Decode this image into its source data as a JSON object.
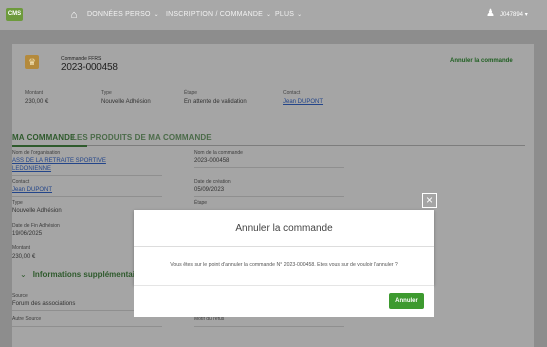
{
  "nav": {
    "logo_text": "CMS",
    "home_icon": "home-icon",
    "items": [
      {
        "label": "DONNÉES PERSO"
      },
      {
        "label": "INSCRIPTION / COMMANDE"
      },
      {
        "label": "PLUS"
      }
    ],
    "user": "J047894 ▾"
  },
  "order": {
    "kind": "Commande FFRS",
    "number": "2023-000458",
    "cancel_label": "Annuler la commande",
    "meta": [
      {
        "label": "Montant",
        "value": "230,00 €"
      },
      {
        "label": "Type",
        "value": "Nouvelle Adhésion"
      },
      {
        "label": "Étape",
        "value": "En attente de validation"
      },
      {
        "label": "Contact",
        "value": "Jean DUPONT"
      }
    ]
  },
  "tabs": [
    {
      "label": "MA COMMANDE"
    },
    {
      "label": "LES PRODUITS DE MA COMMANDE"
    }
  ],
  "fields": {
    "org_label": "Nom de l'organisation",
    "org_value_1": "ASS DE LA RETRAITE SPORTIVE",
    "org_value_2": "LEDONIENNE",
    "cmd_name_label": "Nom de la commande",
    "cmd_name_value": "2023-000458",
    "contact_label": "Contact",
    "contact_value": "Jean DUPONT",
    "date_label": "Date de création",
    "date_value": "05/09/2023",
    "type_label": "Type",
    "type_value": "Nouvelle Adhésion",
    "step_label": "Étape",
    "end_date_label": "Date de Fin Adhésion",
    "end_date_value": "19/06/2025",
    "amount_label": "Montant",
    "amount_value": "230,00 €",
    "source_label": "Source",
    "source_value": "Forum des associations",
    "other_source_label": "Autre Source",
    "refusal_label": "Motif du refus"
  },
  "info_heading": "Informations supplémentaires",
  "modal": {
    "title": "Annuler la commande",
    "message": "Vous êtes sur le point d'annuler la commande N° 2023-000458. Etes vous sur de vouloir l'annuler ?",
    "confirm_label": "Annuler",
    "close_icon": "close-icon"
  }
}
